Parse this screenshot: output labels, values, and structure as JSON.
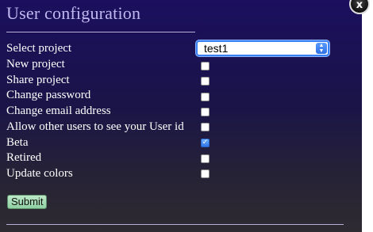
{
  "dialog": {
    "title": "User configuration",
    "close_icon": "close-icon",
    "colors": {
      "panel_top": "#1b0f5e",
      "panel_bottom": "#2e2b31",
      "title": "#c0b8f0",
      "text": "#ffffff",
      "checkbox_checked": "#2d73e6",
      "submit_bg": "#9fd8ae"
    }
  },
  "form": {
    "select_project": {
      "label": "Select project",
      "value": "test1"
    },
    "options": [
      {
        "label": "New project",
        "checked": false
      },
      {
        "label": "Share project",
        "checked": false
      },
      {
        "label": "Change password",
        "checked": false
      },
      {
        "label": "Change email address",
        "checked": false
      },
      {
        "label": "Allow other users to see your User id",
        "checked": false
      },
      {
        "label": "Beta",
        "checked": true
      },
      {
        "label": "Retired",
        "checked": false
      },
      {
        "label": "Update colors",
        "checked": false
      }
    ],
    "submit_label": "Submit"
  }
}
